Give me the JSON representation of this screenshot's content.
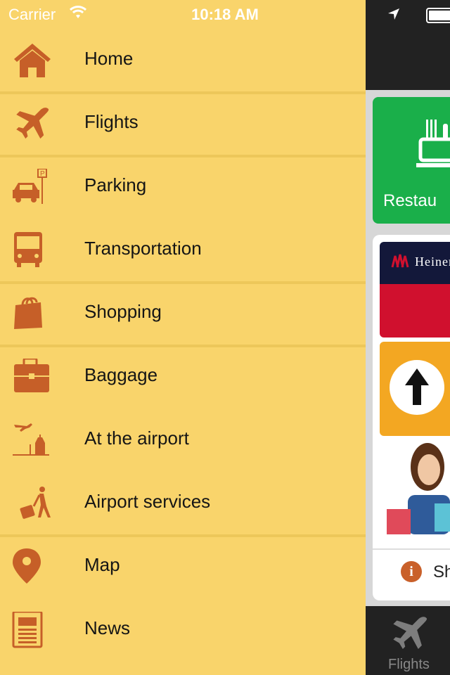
{
  "status_bar": {
    "carrier": "Carrier",
    "time": "10:18 AM"
  },
  "menu": {
    "items": [
      {
        "label": "Home",
        "icon": "home-icon"
      },
      {
        "label": "Flights",
        "icon": "airplane-icon"
      },
      {
        "label": "Parking",
        "icon": "parking-car-icon"
      },
      {
        "label": "Transportation",
        "icon": "bus-icon"
      },
      {
        "label": "Shopping",
        "icon": "shopping-bag-icon"
      },
      {
        "label": "Baggage",
        "icon": "briefcase-icon"
      },
      {
        "label": "At the airport",
        "icon": "airport-building-icon"
      },
      {
        "label": "Airport services",
        "icon": "traveler-luggage-icon"
      },
      {
        "label": "Map",
        "icon": "map-pin-icon"
      },
      {
        "label": "News",
        "icon": "newspaper-icon"
      }
    ],
    "icon_color": "#c65f28",
    "background": "#f9d46b"
  },
  "content": {
    "restaurant_label": "Restau",
    "ad_brand": "Heiner",
    "info_text": "Sh"
  },
  "tabbar": {
    "flights_label": "Flights"
  }
}
